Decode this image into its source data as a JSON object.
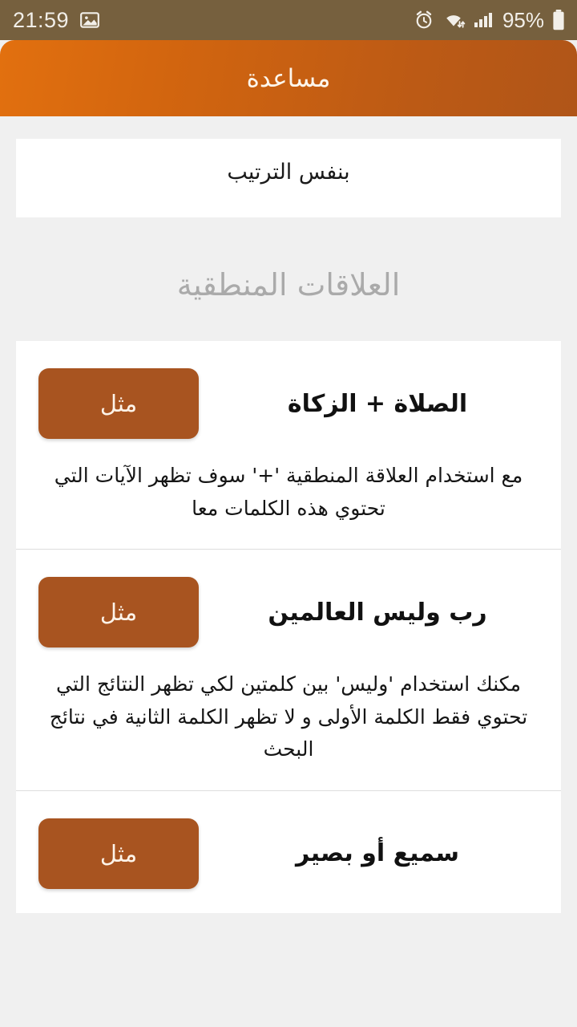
{
  "status_bar": {
    "time": "21:59",
    "battery_percent": "95%",
    "icons": [
      "image-icon",
      "alarm-icon",
      "wifi-icon",
      "signal-icon",
      "battery-icon"
    ],
    "background_color": "#76603E"
  },
  "app_bar": {
    "title": "مساعدة",
    "gradient_from": "#E2700F",
    "gradient_to": "#B05518"
  },
  "tail_card": {
    "text": "بنفس الترتيب"
  },
  "section": {
    "header": "العلاقات المنطقية"
  },
  "examples": [
    {
      "title": "الصلاة + الزكاة",
      "button_label": "مثل",
      "description": "مع استخدام العلاقة المنطقية '+' سوف تظهر الآيات التي تحتوي هذه الكلمات معا"
    },
    {
      "title": "رب وليس العالمين",
      "button_label": "مثل",
      "description": "مكنك استخدام 'وليس' بين كلمتين لكي تظهر النتائج التي تحتوي فقط الكلمة الأولى و لا تظهر الكلمة الثانية في نتائج البحث"
    },
    {
      "title": "سميع أو بصير",
      "button_label": "مثل",
      "description": ""
    }
  ],
  "theme": {
    "accent": "#A85420",
    "page_background": "#F0F0F0",
    "card_background": "#FFFFFF",
    "section_header_color": "#AAAAAA"
  }
}
